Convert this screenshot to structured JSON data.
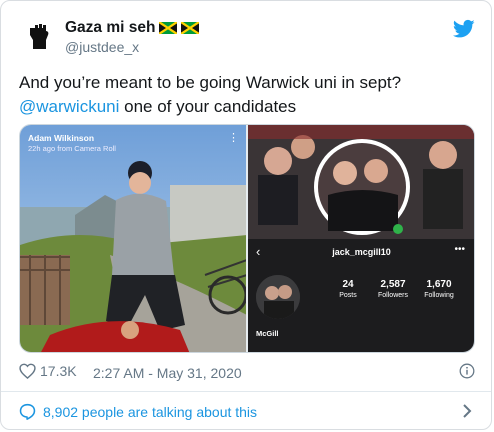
{
  "author": {
    "display_name": "Gaza mi seh",
    "handle": "@justdee_x",
    "avatar_icon": "raised-fist-icon",
    "name_flags": [
      "jamaica-flag-icon",
      "jamaica-flag-icon"
    ]
  },
  "tweet": {
    "text_line1": "And you’re meant to be going Warwick uni in sept?",
    "mention": "@warwickuni",
    "text_line2_rest": " one of your candidates"
  },
  "media": {
    "left_photo": {
      "story_user": "Adam Wilkinson",
      "story_meta": "22h ago from Camera Roll"
    },
    "right_photo": {
      "profile_username": "jack_mcgill10",
      "posts_count": "24",
      "posts_label": "Posts",
      "followers_count": "2,587",
      "followers_label": "Followers",
      "following_count": "1,670",
      "following_label": "Following",
      "profile_name": "McGill"
    }
  },
  "footer": {
    "like_count": "17.3K",
    "timestamp": "2:27 AM - May 31, 2020"
  },
  "conversation": {
    "label": "8,902 people are talking about this"
  },
  "colors": {
    "link": "#1b95e0",
    "muted": "#657786",
    "text": "#14171a"
  }
}
